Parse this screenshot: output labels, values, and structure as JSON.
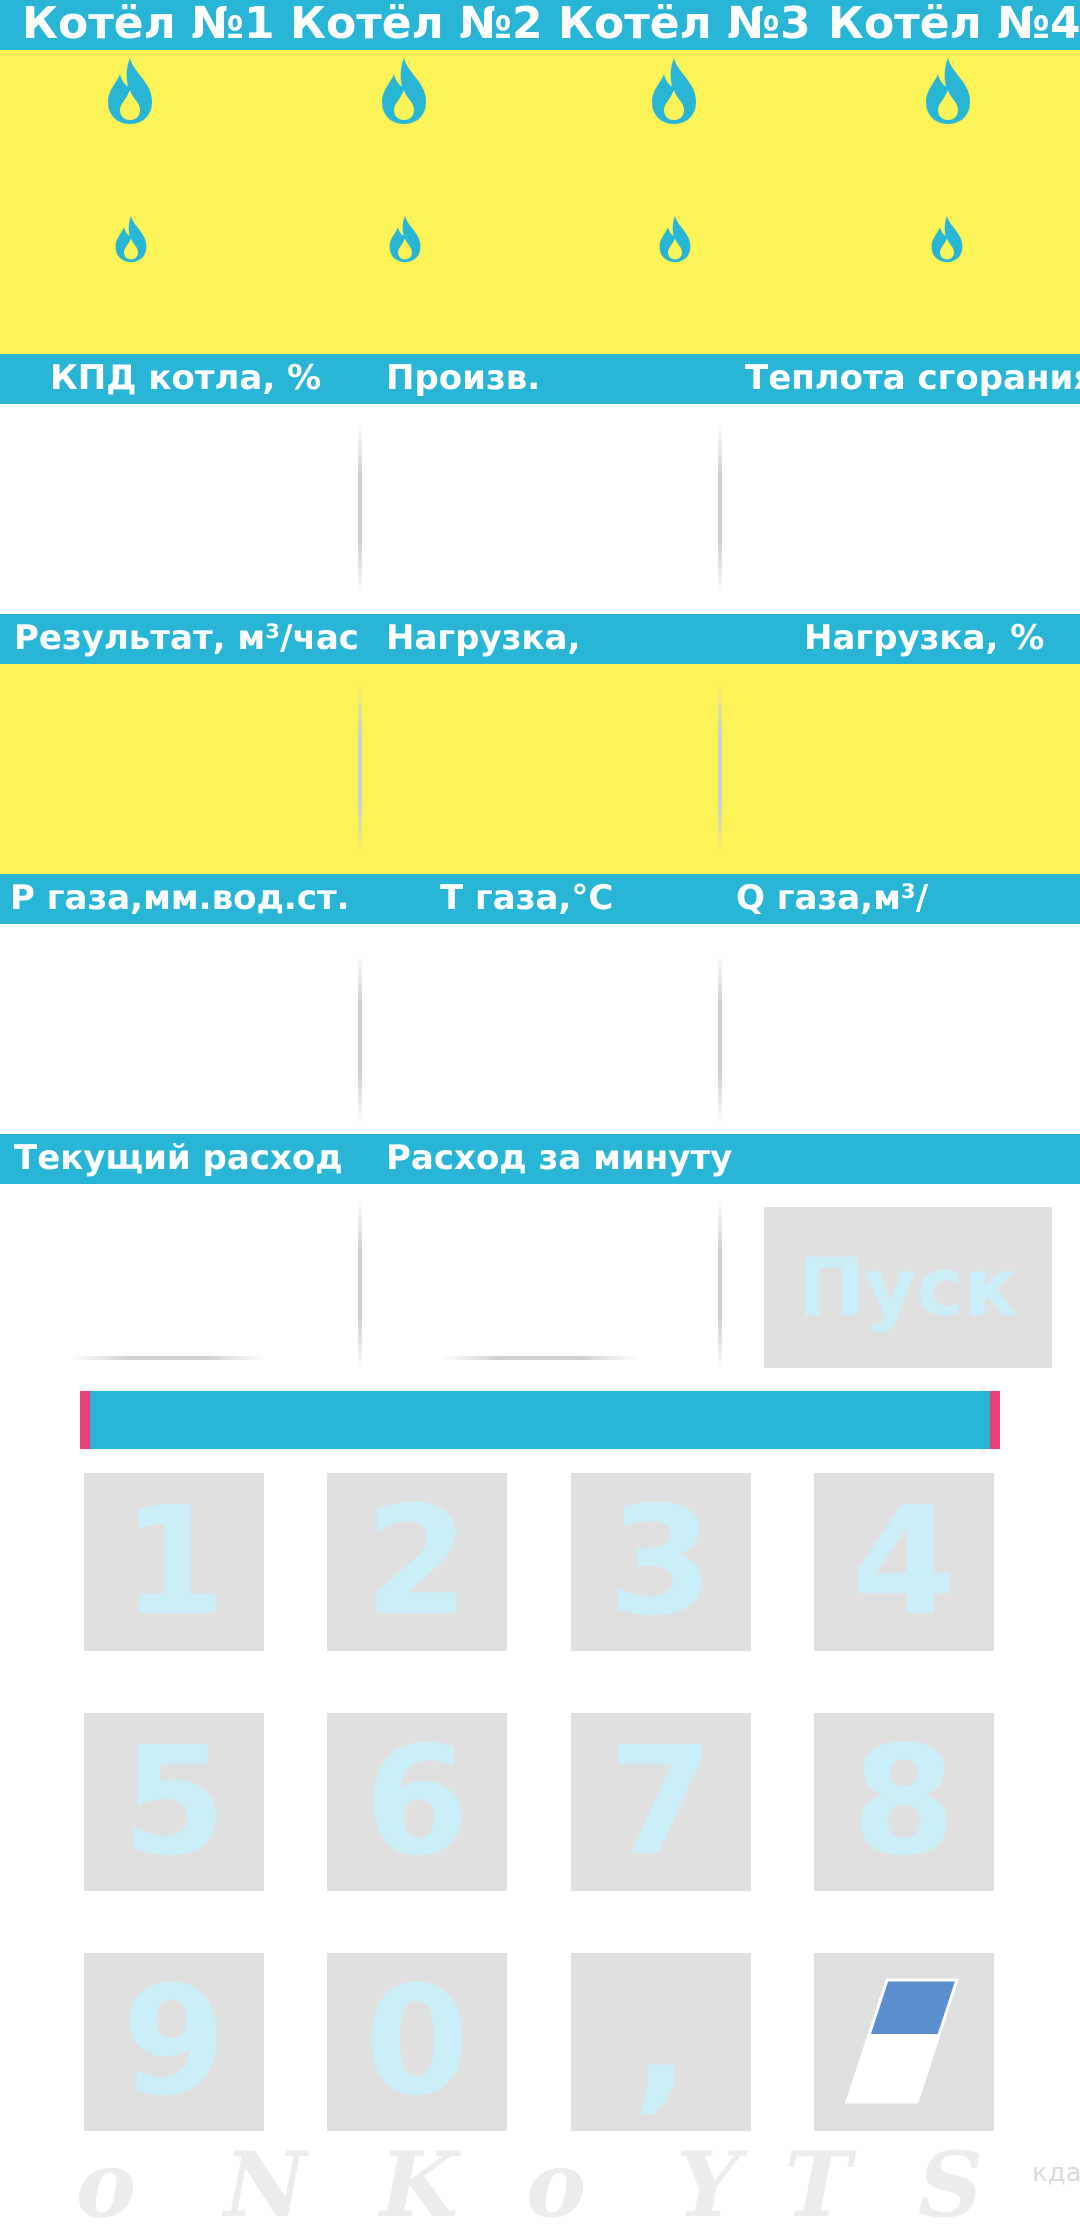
{
  "boilers": [
    {
      "label": "Котёл №1"
    },
    {
      "label": "Котёл №2"
    },
    {
      "label": "Котёл №3"
    },
    {
      "label": "Котёл №4"
    }
  ],
  "section1": {
    "headers": [
      "КПД котла, %",
      "Произв.",
      "Теплота сгорания"
    ],
    "values": [
      "",
      "",
      ""
    ]
  },
  "section2": {
    "headers": [
      "Результат, м³/час",
      "Нагрузка,",
      "Нагрузка, %"
    ],
    "values": [
      "",
      "",
      ""
    ]
  },
  "section3": {
    "headers": [
      "P газа,мм.вод.ст.",
      "T газа,°C",
      "Q газа,м³/"
    ],
    "values": [
      "",
      "",
      ""
    ]
  },
  "section4": {
    "headers": [
      "Текущий расход",
      "Расход за минуту"
    ],
    "values": [
      "",
      ""
    ]
  },
  "start_button": {
    "label": "Пуск"
  },
  "progress": {
    "value": 1.0
  },
  "keypad": {
    "keys": [
      "1",
      "2",
      "3",
      "4",
      "5",
      "6",
      "7",
      "8",
      "9",
      "0",
      ","
    ],
    "erase_icon": "eraser-icon"
  },
  "footer": {
    "small_text": "кда"
  },
  "colors": {
    "accent": "#29b6d6",
    "yellow": "#fbf357",
    "button_bg": "#dfdfdf",
    "button_text": "#c9eef7",
    "progress_edge": "#e8407a",
    "eraser_blue": "#5b8fd0"
  },
  "icons": {
    "flame": "flame-icon"
  }
}
